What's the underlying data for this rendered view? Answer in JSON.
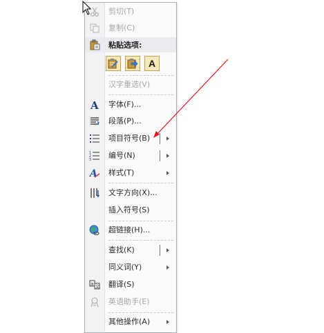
{
  "menu": {
    "cut": {
      "label": "剪切(T)",
      "icon": "scissors-icon",
      "disabled": true
    },
    "copy": {
      "label": "复制(C)",
      "icon": "copy-icon",
      "disabled": true
    },
    "paste_options": {
      "label": "粘贴选项:",
      "icon": "clipboard-paste-icon",
      "buttons": [
        {
          "name": "keep-source-formatting",
          "icon": "paste-keep-format-icon"
        },
        {
          "name": "merge-formatting",
          "icon": "paste-merge-icon"
        },
        {
          "name": "keep-text-only",
          "letter": "A",
          "icon": "paste-text-only-icon"
        }
      ]
    },
    "reconvert": {
      "label": "汉字重选(V)",
      "disabled": true
    },
    "font": {
      "label": "字体(F)...",
      "icon": "font-icon"
    },
    "paragraph": {
      "label": "段落(P)...",
      "icon": "paragraph-icon"
    },
    "bullets": {
      "label": "项目符号(B)",
      "icon": "bullets-icon"
    },
    "numbering": {
      "label": "编号(N)",
      "icon": "numbering-icon"
    },
    "styles": {
      "label": "样式(T)",
      "icon": "styles-icon"
    },
    "text_direction": {
      "label": "文字方向(X)...",
      "icon": "text-direction-icon"
    },
    "insert_symbol": {
      "label": "插入符号(S)"
    },
    "hyperlink": {
      "label": "超链接(H)...",
      "icon": "hyperlink-globe-icon"
    },
    "lookup": {
      "label": "查找(K)"
    },
    "synonyms": {
      "label": "同义词(Y)"
    },
    "translate": {
      "label": "翻译(S)",
      "icon": "translate-icon"
    },
    "english_assistant": {
      "label": "英语助手(E)",
      "icon": "english-assistant-icon",
      "disabled": true
    },
    "more_actions": {
      "label": "其他操作(A)"
    }
  },
  "colors": {
    "annotation_arrow": "#e8141b",
    "disabled_text": "#a6a6a6"
  }
}
